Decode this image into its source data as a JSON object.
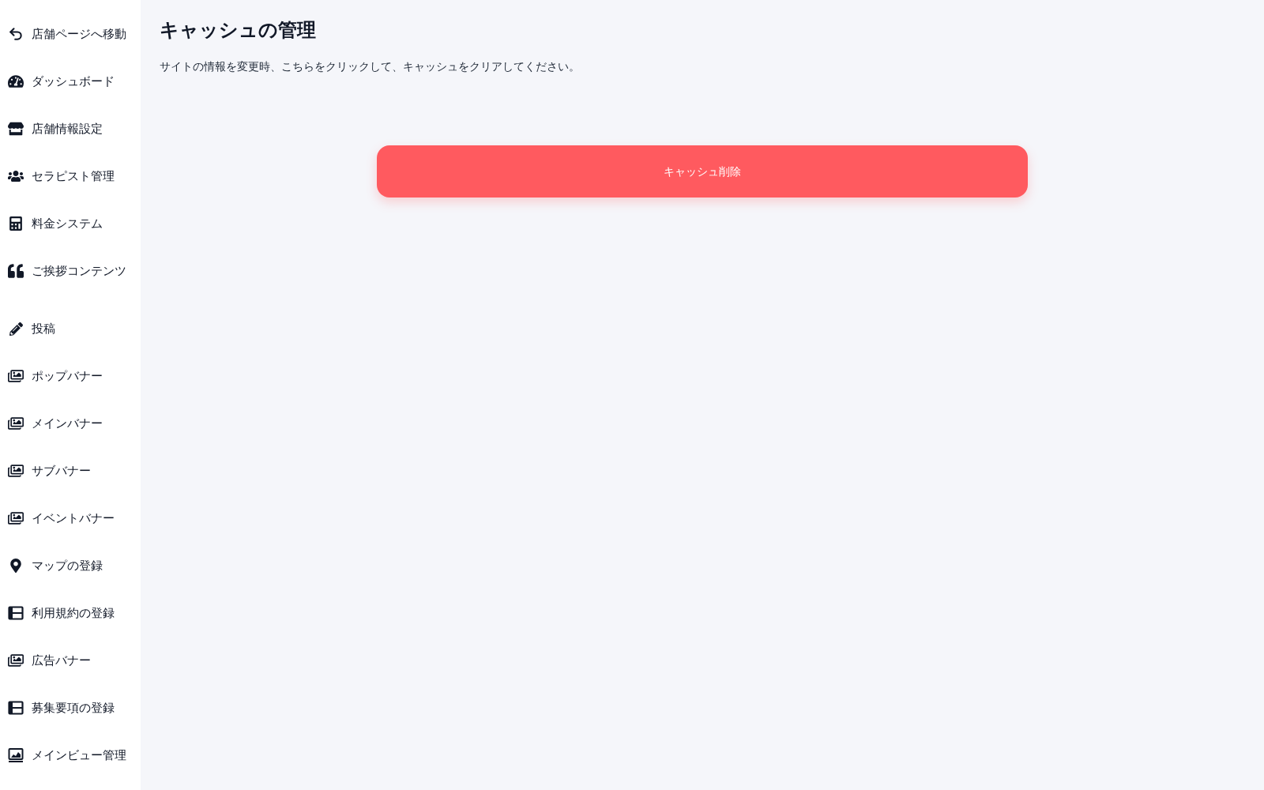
{
  "sidebar": {
    "groups": [
      {
        "items": [
          {
            "label": "店舗ページへ移動"
          },
          {
            "label": "ダッシュボード"
          },
          {
            "label": "店舗情報設定"
          },
          {
            "label": "セラピスト管理"
          },
          {
            "label": "料金システム"
          },
          {
            "label": "ご挨拶コンテンツ"
          }
        ]
      },
      {
        "items": [
          {
            "label": "投稿"
          },
          {
            "label": "ポップバナー"
          },
          {
            "label": "メインバナー"
          },
          {
            "label": "サブバナー"
          },
          {
            "label": "イベントバナー"
          },
          {
            "label": "マップの登録"
          },
          {
            "label": "利用規約の登録"
          },
          {
            "label": "広告バナー"
          },
          {
            "label": "募集要項の登録"
          },
          {
            "label": "メインビュー管理"
          }
        ]
      }
    ]
  },
  "page": {
    "title": "キャッシュの管理",
    "description": "サイトの情報を変更時、こちらをクリックして、キャッシュをクリアしてください。"
  },
  "clear_button": {
    "label": "キャッシュ削除"
  }
}
